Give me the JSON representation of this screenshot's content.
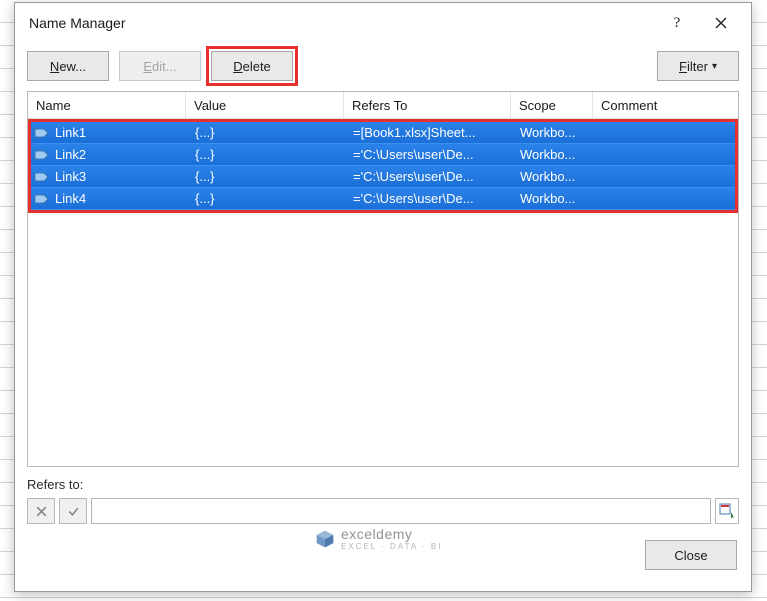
{
  "dialog": {
    "title": "Name Manager",
    "help_symbol": "?",
    "toolbar": {
      "new_label": "New...",
      "edit_label": "Edit...",
      "delete_label": "Delete",
      "filter_label": "Filter"
    }
  },
  "columns": {
    "name": "Name",
    "value": "Value",
    "refers": "Refers To",
    "scope": "Scope",
    "comment": "Comment"
  },
  "rows": [
    {
      "name": "Link1",
      "value": "{...}",
      "refers": "=[Book1.xlsx]Sheet...",
      "scope": "Workbo...",
      "comment": ""
    },
    {
      "name": "Link2",
      "value": "{...}",
      "refers": "='C:\\Users\\user\\De...",
      "scope": "Workbo...",
      "comment": ""
    },
    {
      "name": "Link3",
      "value": "{...}",
      "refers": "='C:\\Users\\user\\De...",
      "scope": "Workbo...",
      "comment": ""
    },
    {
      "name": "Link4",
      "value": "{...}",
      "refers": "='C:\\Users\\user\\De...",
      "scope": "Workbo...",
      "comment": ""
    }
  ],
  "refers_section": {
    "label": "Refers to:",
    "value": ""
  },
  "footer": {
    "close_label": "Close"
  },
  "watermark": {
    "brand": "exceldemy",
    "tagline": "EXCEL · DATA · BI"
  }
}
